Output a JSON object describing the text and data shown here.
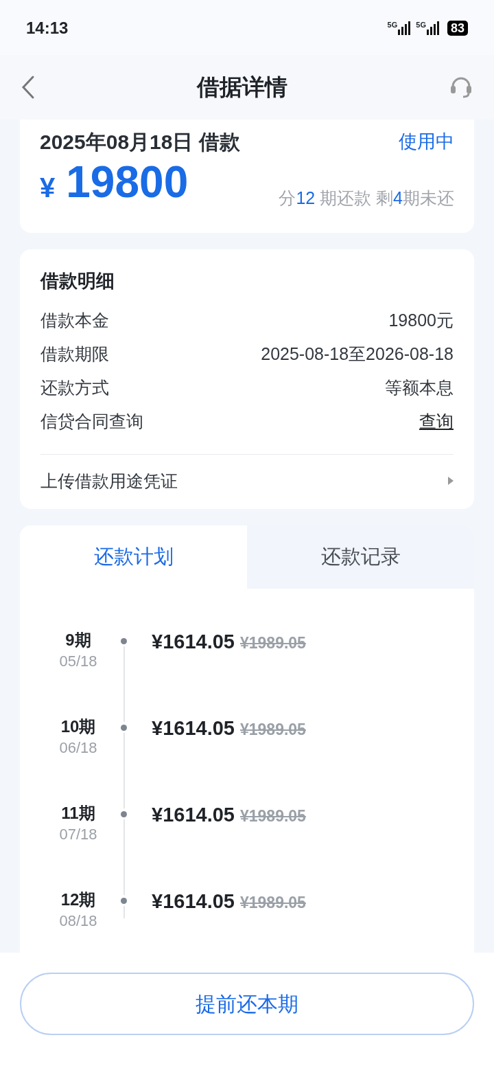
{
  "status_bar": {
    "time": "14:13",
    "network_1": "5G",
    "network_2": "5G",
    "battery": "83"
  },
  "header": {
    "title": "借据详情"
  },
  "loan": {
    "date": "2025年08月18日 借款",
    "status": "使用中",
    "currency": "¥",
    "amount": "19800",
    "summary": [
      {
        "text": "分",
        "highlight": false
      },
      {
        "text": "12",
        "highlight": true
      },
      {
        "text": " 期还款 剩",
        "highlight": false
      },
      {
        "text": "4",
        "highlight": true
      },
      {
        "text": "期未还",
        "highlight": false
      }
    ]
  },
  "details": {
    "title": "借款明细",
    "rows": [
      {
        "label": "借款本金",
        "value": "19800元",
        "kind": "text"
      },
      {
        "label": "借款期限",
        "value": "2025-08-18至2026-08-18",
        "kind": "text"
      },
      {
        "label": "还款方式",
        "value": "等额本息",
        "kind": "text"
      },
      {
        "label": "信贷合同查询",
        "value": "查询",
        "kind": "link"
      }
    ],
    "upload": {
      "label": "上传借款用途凭证"
    }
  },
  "tabs": [
    {
      "label": "还款计划",
      "selected": true
    },
    {
      "label": "还款记录",
      "selected": false
    }
  ],
  "schedule": [
    {
      "period": "9期",
      "date": "05/18",
      "amount": "¥1614.05",
      "original": "¥1989.05"
    },
    {
      "period": "10期",
      "date": "06/18",
      "amount": "¥1614.05",
      "original": "¥1989.05"
    },
    {
      "period": "11期",
      "date": "07/18",
      "amount": "¥1614.05",
      "original": "¥1989.05"
    },
    {
      "period": "12期",
      "date": "08/18",
      "amount": "¥1614.05",
      "original": "¥1989.05"
    }
  ],
  "button": "提前还本期"
}
